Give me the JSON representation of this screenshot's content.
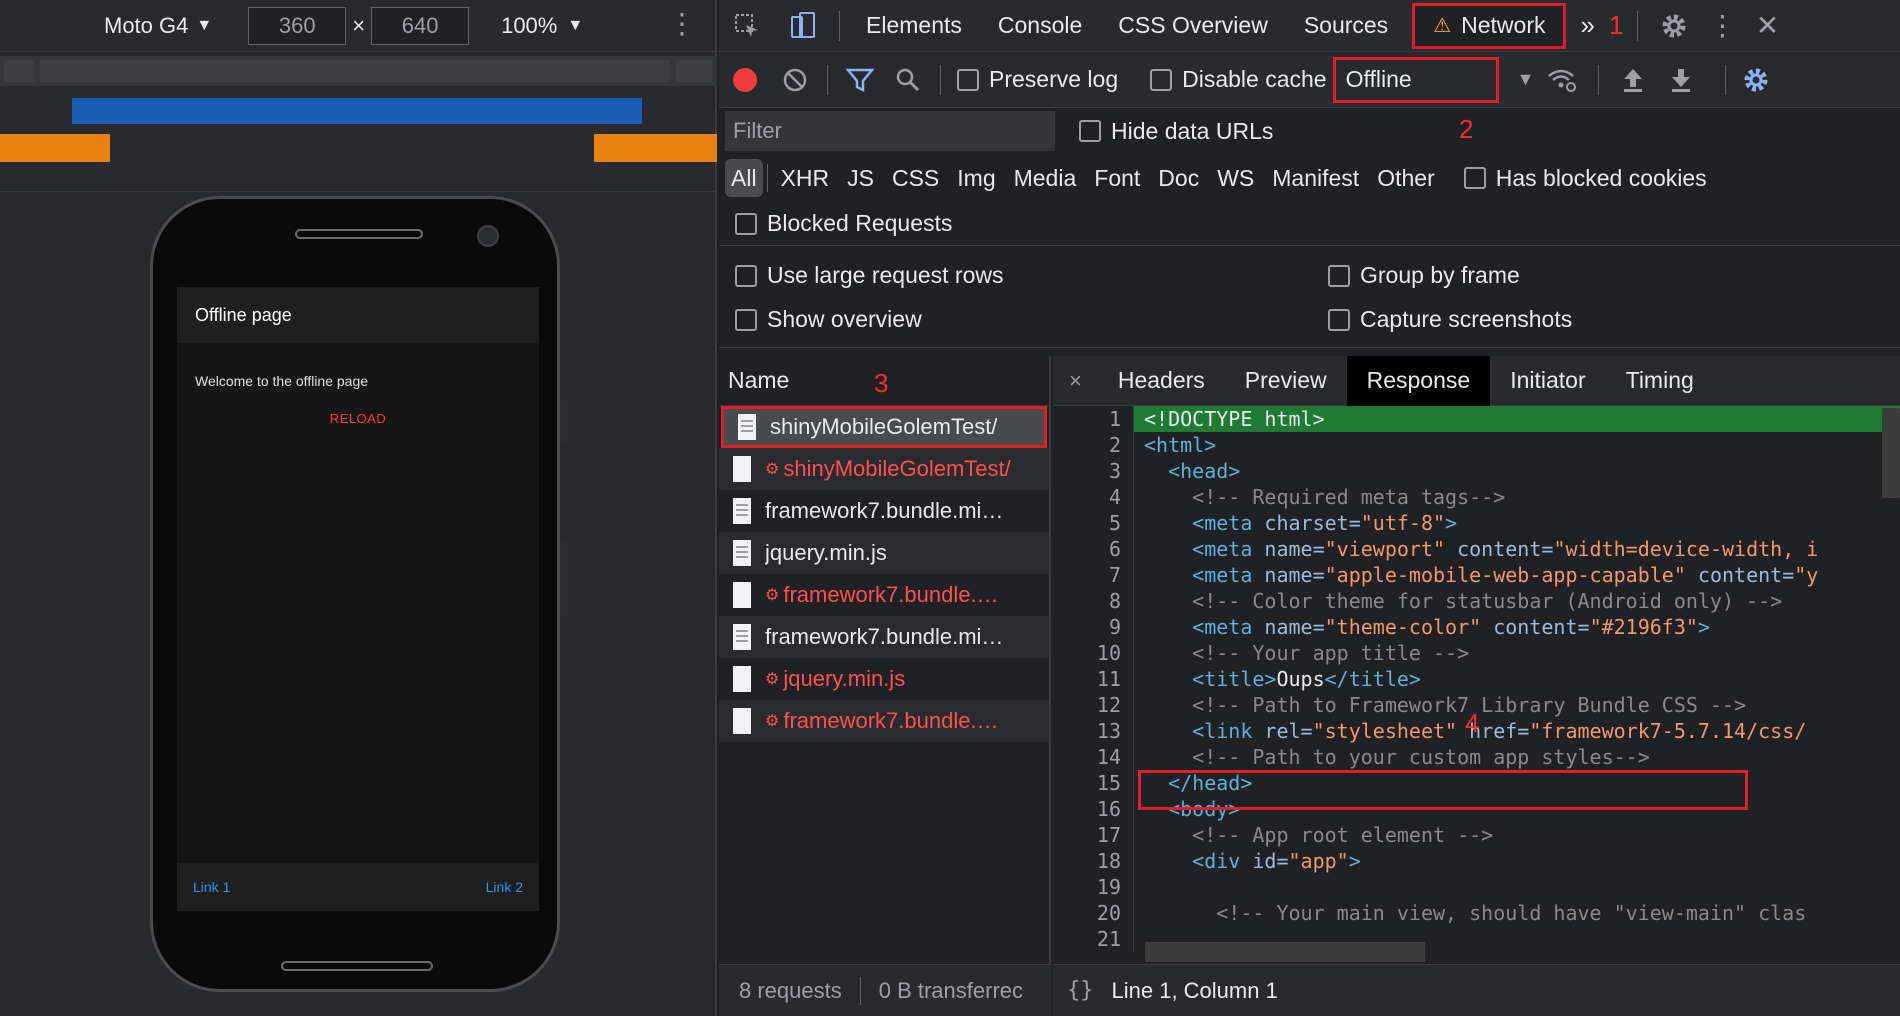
{
  "device_toolbar": {
    "device": "Moto G4",
    "width": "360",
    "height": "640",
    "x_sign": "×",
    "zoom": "100%"
  },
  "phone_app": {
    "nav_title": "Offline page",
    "message": "Welcome to the offline page",
    "reload_label": "RELOAD",
    "link1": "Link 1",
    "link2": "Link 2"
  },
  "devtools_tabs": {
    "elements": "Elements",
    "console": "Console",
    "css_overview": "CSS Overview",
    "sources": "Sources",
    "network": "Network",
    "more": "»"
  },
  "annotations": {
    "n1": "1",
    "n2": "2",
    "n3": "3",
    "n4": "4"
  },
  "network_toolbar": {
    "preserve_log": "Preserve log",
    "disable_cache": "Disable cache",
    "throttling": "Offline"
  },
  "filter": {
    "placeholder": "Filter",
    "hide_data_urls": "Hide data URLs",
    "types": [
      "All",
      "XHR",
      "JS",
      "CSS",
      "Img",
      "Media",
      "Font",
      "Doc",
      "WS",
      "Manifest",
      "Other"
    ],
    "has_blocked_cookies": "Has blocked cookies",
    "blocked_requests": "Blocked Requests"
  },
  "settings": {
    "large_rows": "Use large request rows",
    "group_by_frame": "Group by frame",
    "show_overview": "Show overview",
    "capture_screenshots": "Capture screenshots"
  },
  "requests": {
    "header": "Name",
    "rows": [
      {
        "name": "shinyMobileGolemTest/",
        "error": false,
        "selected": true
      },
      {
        "name": "shinyMobileGolemTest/",
        "error": true,
        "selected": false
      },
      {
        "name": "framework7.bundle.mi…",
        "error": false,
        "selected": false
      },
      {
        "name": "jquery.min.js",
        "error": false,
        "selected": false
      },
      {
        "name": "framework7.bundle.…",
        "error": true,
        "selected": false
      },
      {
        "name": "framework7.bundle.mi…",
        "error": false,
        "selected": false
      },
      {
        "name": "jquery.min.js",
        "error": true,
        "selected": false
      },
      {
        "name": "framework7.bundle.…",
        "error": true,
        "selected": false
      }
    ],
    "summary_count": "8 requests",
    "summary_transferred": "0 B transferrec"
  },
  "response": {
    "tabs": [
      "Headers",
      "Preview",
      "Response",
      "Initiator",
      "Timing"
    ],
    "active_tab": "Response",
    "close": "×",
    "footer_braces": "{}",
    "footer_position": "Line 1, Column 1",
    "lines": [
      [
        [
          "plain",
          "<!DOCTYPE html>"
        ]
      ],
      [
        [
          "tag",
          "<html>"
        ]
      ],
      [
        [
          "plain",
          "  "
        ],
        [
          "tag",
          "<head>"
        ]
      ],
      [
        [
          "plain",
          "    "
        ],
        [
          "cmt",
          "<!-- Required meta tags-->"
        ]
      ],
      [
        [
          "plain",
          "    "
        ],
        [
          "tag",
          "<meta "
        ],
        [
          "attr",
          "charset="
        ],
        [
          "val",
          "\"utf-8\""
        ],
        [
          "tag",
          ">"
        ]
      ],
      [
        [
          "plain",
          "    "
        ],
        [
          "tag",
          "<meta "
        ],
        [
          "attr",
          "name="
        ],
        [
          "val",
          "\"viewport\""
        ],
        [
          "attr",
          " content="
        ],
        [
          "val",
          "\"width=device-width, i"
        ]
      ],
      [
        [
          "plain",
          "    "
        ],
        [
          "tag",
          "<meta "
        ],
        [
          "attr",
          "name="
        ],
        [
          "val",
          "\"apple-mobile-web-app-capable\""
        ],
        [
          "attr",
          " content="
        ],
        [
          "val",
          "\"y"
        ]
      ],
      [
        [
          "plain",
          "    "
        ],
        [
          "cmt",
          "<!-- Color theme for statusbar (Android only) -->"
        ]
      ],
      [
        [
          "plain",
          "    "
        ],
        [
          "tag",
          "<meta "
        ],
        [
          "attr",
          "name="
        ],
        [
          "val",
          "\"theme-color\""
        ],
        [
          "attr",
          " content="
        ],
        [
          "val",
          "\"#2196f3\""
        ],
        [
          "tag",
          ">"
        ]
      ],
      [
        [
          "plain",
          "    "
        ],
        [
          "cmt",
          "<!-- Your app title -->"
        ]
      ],
      [
        [
          "plain",
          "    "
        ],
        [
          "tag",
          "<title>"
        ],
        [
          "plain",
          "Oups"
        ],
        [
          "tag",
          "</title>"
        ]
      ],
      [
        [
          "plain",
          "    "
        ],
        [
          "cmt",
          "<!-- Path to Framework7 Library Bundle CSS -->"
        ]
      ],
      [
        [
          "plain",
          "    "
        ],
        [
          "tag",
          "<link "
        ],
        [
          "attr",
          "rel="
        ],
        [
          "val",
          "\"stylesheet\""
        ],
        [
          "attr",
          " href="
        ],
        [
          "val",
          "\"framework7-5.7.14/css/"
        ]
      ],
      [
        [
          "plain",
          "    "
        ],
        [
          "cmt",
          "<!-- Path to your custom app styles-->"
        ]
      ],
      [
        [
          "plain",
          "  "
        ],
        [
          "tag",
          "</head>"
        ]
      ],
      [
        [
          "plain",
          "  "
        ],
        [
          "tag",
          "<body>"
        ]
      ],
      [
        [
          "plain",
          "    "
        ],
        [
          "cmt",
          "<!-- App root element -->"
        ]
      ],
      [
        [
          "plain",
          "    "
        ],
        [
          "tag",
          "<div "
        ],
        [
          "attr",
          "id="
        ],
        [
          "val",
          "\"app\""
        ],
        [
          "tag",
          ">"
        ]
      ],
      [
        [
          "plain",
          ""
        ]
      ],
      [
        [
          "plain",
          "      "
        ],
        [
          "cmt",
          "<!-- Your main view, should have \"view-main\" clas"
        ]
      ],
      [
        [
          "plain",
          ""
        ]
      ]
    ]
  }
}
